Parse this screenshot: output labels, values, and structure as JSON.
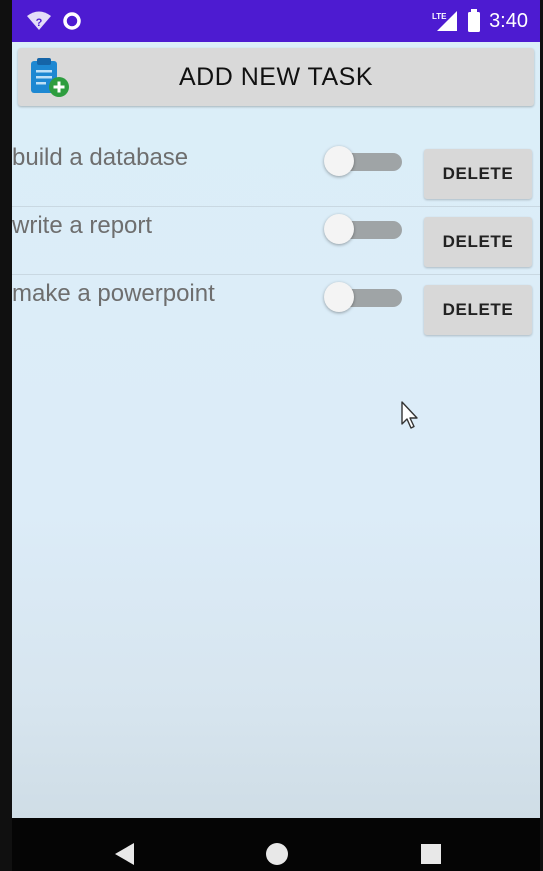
{
  "status_bar": {
    "time": "3:40",
    "network_label": "LTE",
    "background_color": "#4d1bd1",
    "icons": [
      "wifi-unknown-icon",
      "circle-notification-icon",
      "lte-signal-icon",
      "battery-icon"
    ]
  },
  "header": {
    "add_button_label": "ADD NEW TASK",
    "icon": "clipboard-add-icon"
  },
  "tasks": [
    {
      "name": "build a database",
      "completed": false,
      "delete_label": "DELETE"
    },
    {
      "name": "write a report",
      "completed": false,
      "delete_label": "DELETE"
    },
    {
      "name": "make a powerpoint",
      "completed": false,
      "delete_label": "DELETE"
    }
  ],
  "nav_bar": {
    "buttons": [
      "back-icon",
      "home-icon",
      "recents-icon"
    ]
  },
  "colors": {
    "app_background": "#dbeef8",
    "button_gray": "#d8d8d8",
    "task_text": "#6e6e6e"
  }
}
